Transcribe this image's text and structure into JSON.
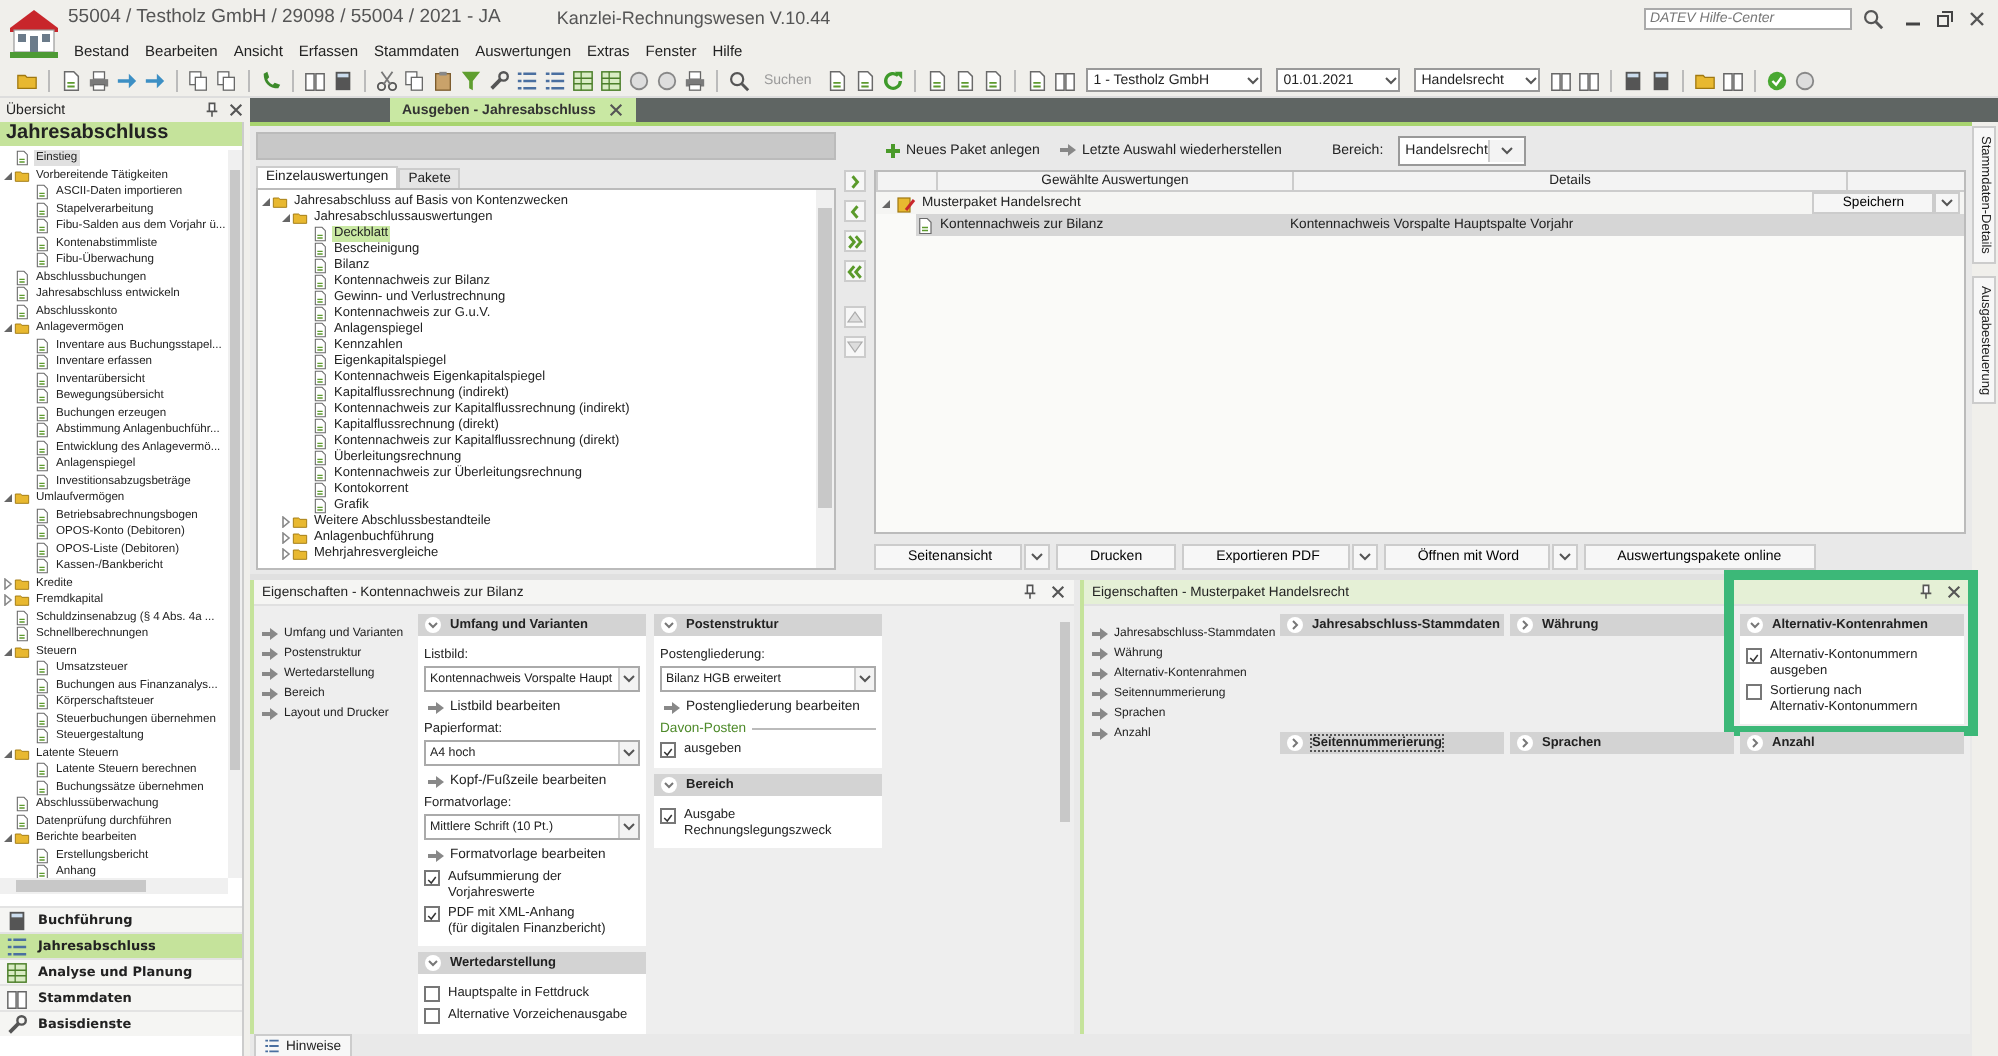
{
  "window": {
    "title": "55004 / Testholz GmbH / 29098 / 55004 / 2021 - JA",
    "app": "Kanzlei-Rechnungswesen V.10.44"
  },
  "help_search": {
    "placeholder": "DATEV Hilfe-Center"
  },
  "menu": [
    "Bestand",
    "Bearbeiten",
    "Ansicht",
    "Erfassen",
    "Stammdaten",
    "Auswertungen",
    "Extras",
    "Fenster",
    "Hilfe"
  ],
  "toolbar": {
    "search": "Suchen",
    "client": "1 - Testholz GmbH",
    "date": "01.01.2021",
    "law": "Handelsrecht"
  },
  "overview": {
    "title": "Übersicht",
    "heading": "Jahresabschluss",
    "tree": [
      {
        "label": "Einstieg",
        "kind": "page",
        "selected": true
      },
      {
        "label": "Vorbereitende Tätigkeiten",
        "kind": "folder",
        "expanded": true,
        "selected": false,
        "children": [
          {
            "label": "ASCII-Daten importieren",
            "kind": "page",
            "selected": false
          },
          {
            "label": "Stapelverarbeitung",
            "kind": "page",
            "selected": false
          },
          {
            "label": "Fibu-Salden aus dem Vorjahr ü...",
            "kind": "page",
            "selected": false
          },
          {
            "label": "Kontenabstimmliste",
            "kind": "page",
            "selected": false
          },
          {
            "label": "Fibu-Überwachung",
            "kind": "page",
            "selected": false
          }
        ]
      },
      {
        "label": "Abschlussbuchungen",
        "kind": "page",
        "selected": false
      },
      {
        "label": "Jahresabschluss entwickeln",
        "kind": "page",
        "selected": false
      },
      {
        "label": "Abschlusskonto",
        "kind": "page",
        "selected": false
      },
      {
        "label": "Anlagevermögen",
        "kind": "folder",
        "expanded": true,
        "selected": false,
        "children": [
          {
            "label": "Inventare aus Buchungsstapel...",
            "kind": "page",
            "selected": false
          },
          {
            "label": "Inventare erfassen",
            "kind": "page",
            "selected": false
          },
          {
            "label": "Inventarübersicht",
            "kind": "page",
            "selected": false
          },
          {
            "label": "Bewegungsübersicht",
            "kind": "page",
            "selected": false
          },
          {
            "label": "Buchungen erzeugen",
            "kind": "page",
            "selected": false
          },
          {
            "label": "Abstimmung Anlagenbuchführ...",
            "kind": "page",
            "selected": false
          },
          {
            "label": "Entwicklung des Anlagevermö...",
            "kind": "page",
            "selected": false
          },
          {
            "label": "Anlagenspiegel",
            "kind": "page",
            "selected": false
          },
          {
            "label": "Investitionsabzugsbeträge",
            "kind": "page",
            "selected": false
          }
        ]
      },
      {
        "label": "Umlaufvermögen",
        "kind": "folder",
        "expanded": true,
        "selected": false,
        "children": [
          {
            "label": "Betriebsabrechnungsbogen",
            "kind": "page",
            "selected": false
          },
          {
            "label": "OPOS-Konto (Debitoren)",
            "kind": "page",
            "selected": false
          },
          {
            "label": "OPOS-Liste (Debitoren)",
            "kind": "page",
            "selected": false
          },
          {
            "label": "Kassen-/Bankbericht",
            "kind": "page",
            "selected": false
          }
        ]
      },
      {
        "label": "Kredite",
        "kind": "folder",
        "expanded": false,
        "selected": false
      },
      {
        "label": "Fremdkapital",
        "kind": "folder",
        "expanded": false,
        "selected": false
      },
      {
        "label": "Schuldzinsenabzug (§ 4 Abs. 4a ...",
        "kind": "page",
        "selected": false
      },
      {
        "label": "Schnellberechnungen",
        "kind": "page",
        "selected": false
      },
      {
        "label": "Steuern",
        "kind": "folder",
        "expanded": true,
        "selected": false,
        "children": [
          {
            "label": "Umsatzsteuer",
            "kind": "page",
            "selected": false
          },
          {
            "label": "Buchungen aus Finanzanalys...",
            "kind": "page",
            "selected": false
          },
          {
            "label": "Körperschaftsteuer",
            "kind": "page",
            "selected": false
          },
          {
            "label": "Steuerbuchungen übernehmen",
            "kind": "page",
            "selected": false
          },
          {
            "label": "Steuergestaltung",
            "kind": "page",
            "selected": false
          }
        ]
      },
      {
        "label": "Latente Steuern",
        "kind": "folder",
        "expanded": true,
        "selected": false,
        "children": [
          {
            "label": "Latente Steuern berechnen",
            "kind": "page",
            "selected": false
          },
          {
            "label": "Buchungssätze übernehmen",
            "kind": "page",
            "selected": false
          }
        ]
      },
      {
        "label": "Abschlussüberwachung",
        "kind": "page",
        "selected": false
      },
      {
        "label": "Datenprüfung durchführen",
        "kind": "page",
        "selected": false
      },
      {
        "label": "Berichte bearbeiten",
        "kind": "folder",
        "expanded": true,
        "selected": false,
        "children": [
          {
            "label": "Erstellungsbericht",
            "kind": "page",
            "selected": false
          },
          {
            "label": "Anhang",
            "kind": "page",
            "selected": false
          }
        ]
      }
    ],
    "nav": [
      {
        "label": "Buchführung",
        "selected": false
      },
      {
        "label": "Jahresabschluss",
        "selected": true
      },
      {
        "label": "Analyse und Planung",
        "selected": false
      },
      {
        "label": "Stammdaten",
        "selected": false
      },
      {
        "label": "Basisdienste",
        "selected": false
      }
    ]
  },
  "document_tab": {
    "label": "Ausgeben - Jahresabschluss"
  },
  "reports": {
    "tabs": [
      {
        "label": "Einzelauswertungen",
        "selected": true
      },
      {
        "label": "Pakete",
        "selected": false
      }
    ],
    "tree": [
      {
        "label": "Jahresabschluss auf Basis von Kontenzwecken",
        "kind": "folder",
        "expanded": true,
        "selected": false,
        "children": [
          {
            "label": "Jahresabschlussauswertungen",
            "kind": "folder",
            "expanded": true,
            "selected": false,
            "children": [
              {
                "label": "Deckblatt",
                "kind": "page",
                "selected": true
              },
              {
                "label": "Bescheinigung",
                "kind": "page",
                "selected": false
              },
              {
                "label": "Bilanz",
                "kind": "page",
                "selected": false
              },
              {
                "label": "Kontennachweis zur Bilanz",
                "kind": "page",
                "selected": false
              },
              {
                "label": "Gewinn- und Verlustrechnung",
                "kind": "page",
                "selected": false
              },
              {
                "label": "Kontennachweis zur G.u.V.",
                "kind": "page",
                "selected": false
              },
              {
                "label": "Anlagenspiegel",
                "kind": "page",
                "selected": false
              },
              {
                "label": "Kennzahlen",
                "kind": "page",
                "selected": false
              },
              {
                "label": "Eigenkapitalspiegel",
                "kind": "page",
                "selected": false
              },
              {
                "label": "Kontennachweis Eigenkapitalspiegel",
                "kind": "page",
                "selected": false
              },
              {
                "label": "Kapitalflussrechnung (indirekt)",
                "kind": "page",
                "selected": false
              },
              {
                "label": "Kontennachweis zur Kapitalflussrechnung (indirekt)",
                "kind": "page",
                "selected": false
              },
              {
                "label": "Kapitalflussrechnung (direkt)",
                "kind": "page",
                "selected": false
              },
              {
                "label": "Kontennachweis zur Kapitalflussrechnung (direkt)",
                "kind": "page",
                "selected": false
              },
              {
                "label": "Überleitungsrechnung",
                "kind": "page",
                "selected": false
              },
              {
                "label": "Kontennachweis zur Überleitungsrechnung",
                "kind": "page",
                "selected": false
              },
              {
                "label": "Kontokorrent",
                "kind": "page",
                "selected": false
              },
              {
                "label": "Grafik",
                "kind": "page",
                "selected": false
              }
            ]
          },
          {
            "label": "Weitere Abschlussbestandteile",
            "kind": "folder",
            "expanded": false,
            "selected": false
          },
          {
            "label": "Anlagenbuchführung",
            "kind": "folder",
            "expanded": false,
            "selected": false
          },
          {
            "label": "Mehrjahresvergleiche",
            "kind": "folder",
            "expanded": false,
            "selected": false
          }
        ]
      }
    ]
  },
  "package": {
    "actions": [
      "Neues Paket anlegen",
      "Letzte Auswahl wiederherstellen"
    ],
    "area_label": "Bereich:",
    "area": "Handelsrecht",
    "columns": [
      "Gewählte Auswertungen",
      "Details"
    ],
    "rows": [
      {
        "kind": "package",
        "name": "Musterpaket Handelsrecht",
        "expanded": true,
        "button": "Speichern",
        "selected": false
      },
      {
        "kind": "report",
        "name": "Kontennachweis zur Bilanz",
        "details": "Kontennachweis Vorspalte Hauptspalte Vorjahr",
        "selected": true
      }
    ],
    "buttons": [
      {
        "label": "Seitenansicht",
        "dropdown": true
      },
      {
        "label": "Drucken",
        "dropdown": false
      },
      {
        "label": "Exportieren PDF",
        "dropdown": true
      },
      {
        "label": "Öffnen mit Word",
        "dropdown": true
      },
      {
        "label": "Auswertungspakete online",
        "dropdown": false
      }
    ]
  },
  "side_tabs": [
    "Stammdaten-Details",
    "Ausgabesteuerung"
  ],
  "report_properties": {
    "title": "Eigenschaften - Kontennachweis zur Bilanz",
    "links": [
      "Umfang und Varianten",
      "Postenstruktur",
      "Wertedarstellung",
      "Bereich",
      "Layout und Drucker"
    ],
    "columns": [
      [
        {
          "title": "Umfang und Varianten",
          "expanded": true,
          "items": [
            {
              "kind": "combo",
              "label": "Listbild:",
              "value": "Kontennachweis Vorspalte Haupt"
            },
            {
              "kind": "link",
              "label": "Listbild bearbeiten"
            },
            {
              "kind": "combo",
              "label": "Papierformat:",
              "value": "A4 hoch"
            },
            {
              "kind": "link",
              "label": "Kopf-/Fußzeile bearbeiten"
            },
            {
              "kind": "combo",
              "label": "Formatvorlage:",
              "value": "Mittlere Schrift (10 Pt.)"
            },
            {
              "kind": "link",
              "label": "Formatvorlage bearbeiten"
            },
            {
              "kind": "check",
              "label": "Aufsummierung der Vorjahreswerte",
              "checked": true
            },
            {
              "kind": "check",
              "label": "PDF mit XML-Anhang\n(für digitalen Finanzbericht)",
              "checked": true
            }
          ]
        },
        {
          "title": "Wertedarstellung",
          "expanded": true,
          "items": [
            {
              "kind": "check",
              "label": "Hauptspalte in Fettdruck",
              "checked": false
            },
            {
              "kind": "check",
              "label": "Alternative Vorzeichenausgabe",
              "checked": false
            }
          ]
        }
      ],
      [
        {
          "title": "Postenstruktur",
          "expanded": true,
          "items": [
            {
              "kind": "combo",
              "label": "Postengliederung:",
              "value": "Bilanz HGB erweitert"
            },
            {
              "kind": "link",
              "label": "Postengliederung bearbeiten"
            },
            {
              "kind": "section",
              "label": "Davon-Posten"
            },
            {
              "kind": "check",
              "label": "ausgeben",
              "checked": true
            }
          ]
        },
        {
          "title": "Bereich",
          "expanded": true,
          "items": [
            {
              "kind": "check",
              "label": "Ausgabe Rechnungslegungszweck",
              "checked": true
            }
          ]
        }
      ]
    ]
  },
  "package_properties": {
    "title": "Eigenschaften - Musterpaket Handelsrecht",
    "links": [
      "Jahresabschluss-Stammdaten",
      "Währung",
      "Alternativ-Kontenrahmen",
      "Seitennummerierung",
      "Sprachen",
      "Anzahl"
    ],
    "groups": [
      {
        "title": "Jahresabschluss-Stammdaten",
        "expanded": false,
        "focused": false,
        "highlighted": false
      },
      {
        "title": "Währung",
        "expanded": false,
        "focused": false,
        "highlighted": false
      },
      {
        "title": "Alternativ-Kontenrahmen",
        "expanded": true,
        "focused": false,
        "highlighted": true,
        "items": [
          {
            "kind": "check",
            "label": "Alternativ-Kontonummern ausgeben",
            "checked": true
          },
          {
            "kind": "check",
            "label": "Sortierung nach\nAlternativ-Kontonummern",
            "checked": false
          }
        ]
      },
      {
        "title": "Seitennummerierung",
        "expanded": false,
        "focused": true,
        "highlighted": false
      },
      {
        "title": "Sprachen",
        "expanded": false,
        "focused": false,
        "highlighted": false
      },
      {
        "title": "Anzahl",
        "expanded": false,
        "focused": false,
        "highlighted": false
      }
    ]
  },
  "bottom_tabs": [
    "Hinweise"
  ]
}
